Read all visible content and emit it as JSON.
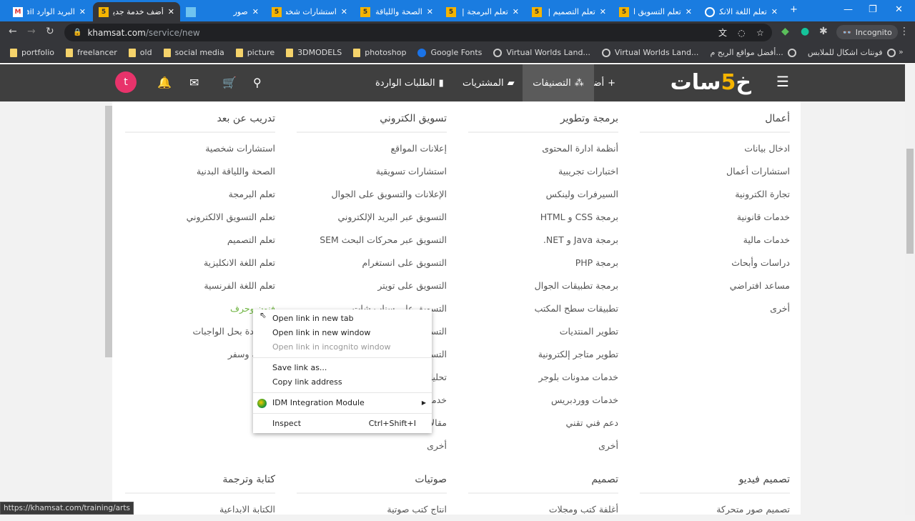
{
  "browser": {
    "tabs": [
      {
        "title": "البريد الوارد nail",
        "icon": "gmail-icon"
      },
      {
        "title": "أضف خدمة جديدة",
        "icon": "khamsat-icon",
        "active": true
      },
      {
        "title": "صور",
        "icon": "photos-icon"
      },
      {
        "title": "استشارات شخصية",
        "icon": "khamsat-icon"
      },
      {
        "title": "الصحة واللياقة",
        "icon": "khamsat-icon"
      },
      {
        "title": "تعلم البرمجة | خمسات",
        "icon": "khamsat-icon"
      },
      {
        "title": "تعلم التصميم | خمسات",
        "icon": "khamsat-icon"
      },
      {
        "title": "تعلم التسويق الالكتروني",
        "icon": "khamsat-icon"
      },
      {
        "title": "تعلم اللغة الانكليزية",
        "icon": "loading-icon"
      }
    ],
    "url_host": "khamsat.com",
    "url_path": "/service/new",
    "profile": "Incognito",
    "bookmarks": [
      {
        "label": "portfolio",
        "icon": "folder-icon"
      },
      {
        "label": "freelancer",
        "icon": "folder-icon"
      },
      {
        "label": "old",
        "icon": "folder-icon"
      },
      {
        "label": "social media",
        "icon": "folder-icon"
      },
      {
        "label": "picture",
        "icon": "folder-icon"
      },
      {
        "label": "3DMODELS",
        "icon": "folder-icon"
      },
      {
        "label": "photoshop",
        "icon": "folder-icon"
      },
      {
        "label": "Google Fonts",
        "icon": "google-fonts-icon"
      },
      {
        "label": "Virtual Worlds Land...",
        "icon": "globe-icon"
      },
      {
        "label": "Virtual Worlds Land...",
        "icon": "globe-icon"
      },
      {
        "label": "أفضل مواقع الربح م...",
        "icon": "bulb-icon"
      },
      {
        "label": "فونتات اشكال للملابس",
        "icon": "image-icon"
      }
    ],
    "status_url": "https://khamsat.com/training/arts"
  },
  "header": {
    "logo": "خمسات",
    "nav": [
      "أضف خدمة",
      "التصنيفات",
      "المشتريات",
      "الطلبات الواردة"
    ],
    "avatar_letter": "t"
  },
  "columns": [
    {
      "title": "أعمال",
      "items": [
        "ادخال بيانات",
        "استشارات أعمال",
        "تجارة الكترونية",
        "خدمات قانونية",
        "خدمات مالية",
        "دراسات وأبحاث",
        "مساعد افتراضي",
        "أخرى"
      ]
    },
    {
      "title": "برمجة وتطوير",
      "items": [
        "أنظمة ادارة المحتوى",
        "اختبارات تجريبية",
        "السيرفرات ولينكس",
        "برمجة CSS و HTML",
        "برمجة Java و NET.",
        "برمجة PHP",
        "برمجة تطبيقات الجوال",
        "تطبيقات سطح المكتب",
        "تطوير المنتديات",
        "تطوير متاجر إلكترونية",
        "خدمات مدونات بلوجر",
        "خدمات ووردبريس",
        "دعم فني تقني",
        "أخرى"
      ]
    },
    {
      "title": "تسويق الكتروني",
      "items": [
        "إعلانات المواقع",
        "استشارات تسويقية",
        "الإعلانات والتسويق على الجوال",
        "التسويق عبر البريد الإلكتروني",
        "التسويق عبر محركات البحث SEM",
        "التسويق على انستغرام",
        "التسويق على تويتر",
        "التسويق على سناب شات",
        "التسويق على فيسبوك",
        "التسويق على يوتيوب",
        "تحليل البيانات",
        "خدمات تسويقية",
        "مقالات تسويقية",
        "أخرى"
      ]
    },
    {
      "title": "تدريب عن بعد",
      "items": [
        "استشارات شخصية",
        "الصحة واللياقة البدنية",
        "تعلم البرمجة",
        "تعلم التسويق الالكتروني",
        "تعلم التصميم",
        "تعلم اللغة الانكليزية",
        "تعلم اللغة الفرنسية",
        "فنون وحرف",
        "مساعدة بحل الواجبات",
        "سياحة وسفر"
      ]
    },
    {
      "title": "تصميم فيديو",
      "items": [
        "تصميم صور متحركة"
      ]
    },
    {
      "title": "تصميم",
      "items": [
        "أغلفة كتب ومجلات"
      ]
    },
    {
      "title": "صوتيات",
      "items": [
        "انتاج كتب صوتية"
      ]
    },
    {
      "title": "كتابة وترجمة",
      "items": [
        "الكتابة الابداعية"
      ]
    }
  ],
  "context_menu": {
    "items": [
      "Open link in new tab",
      "Open link in new window",
      "Open link in incognito window",
      "Save link as...",
      "Copy link address",
      "IDM Integration Module",
      "Inspect"
    ],
    "inspect_shortcut": "Ctrl+Shift+I"
  }
}
